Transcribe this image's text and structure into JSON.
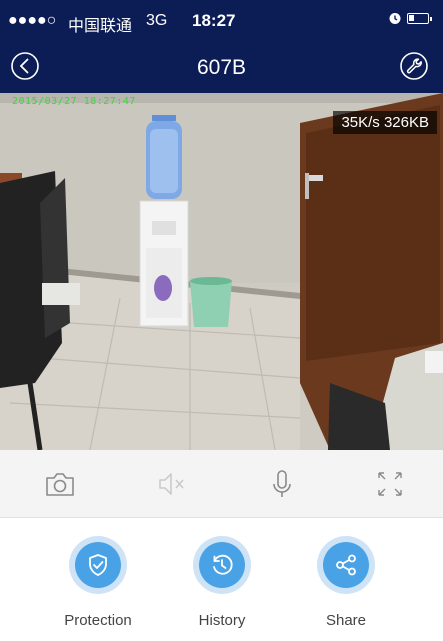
{
  "status_bar": {
    "signal": "●●●●○",
    "carrier": "中国联通",
    "network": "3G",
    "time": "18:27"
  },
  "nav": {
    "title": "607B"
  },
  "video": {
    "timestamp": "2015/03/27 18:27:47",
    "speed": "35K/s  326KB"
  },
  "actions": [
    {
      "label": "Protection"
    },
    {
      "label": "History"
    },
    {
      "label": "Share"
    }
  ],
  "colors": {
    "nav_bg": "#0c1c55",
    "accent": "#4aa2e6",
    "accent_light": "#cfe3f7"
  }
}
